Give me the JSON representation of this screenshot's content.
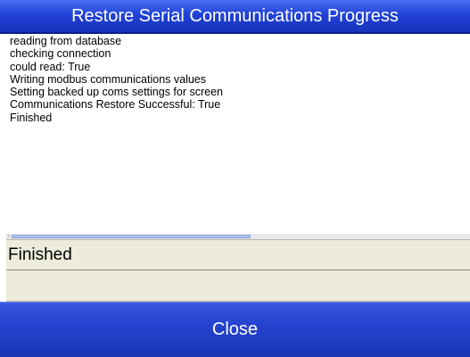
{
  "window": {
    "title": "Restore Serial Communications Progress"
  },
  "log": {
    "lines": [
      "reading from database",
      "checking connection",
      "could read: True",
      "Writing modbus communications values",
      "Setting backed up coms settings for screen",
      "Communications Restore Successful: True",
      "Finished"
    ]
  },
  "scrollbar": {
    "left_arrow": "‹"
  },
  "status": {
    "text": "Finished",
    "secondary_text": ""
  },
  "buttons": {
    "close_label": "Close"
  },
  "colors": {
    "title_bar": "#2142d8",
    "close_button": "#2443cf",
    "field_background": "#ecebdc"
  }
}
